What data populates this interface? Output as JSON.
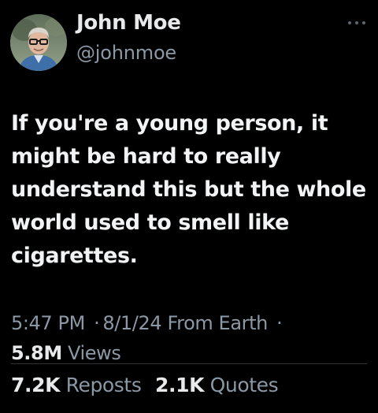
{
  "author": {
    "name": "John Moe",
    "handle": "@johnmoe",
    "avatar_icon": "user-photo-avatar"
  },
  "more_icon": "more-horizontal-icon",
  "tweet": {
    "text": "If you're a young person, it might be hard to really understand this but the whole world used to smell like cigarettes."
  },
  "meta": {
    "time": "5:47 PM",
    "separator": "·",
    "date": "8/1/24",
    "source": "From Earth",
    "trailing_separator": "·"
  },
  "views": {
    "count": "5.8M",
    "label": "Views"
  },
  "stats": {
    "reposts_count": "7.2K",
    "reposts_label": "Reposts",
    "quotes_count": "2.1K",
    "quotes_label": "Quotes"
  },
  "colors": {
    "background": "#000000",
    "primary_text": "#e7e9ea",
    "secondary_text": "#8b98a5",
    "divider": "#2f3336"
  }
}
